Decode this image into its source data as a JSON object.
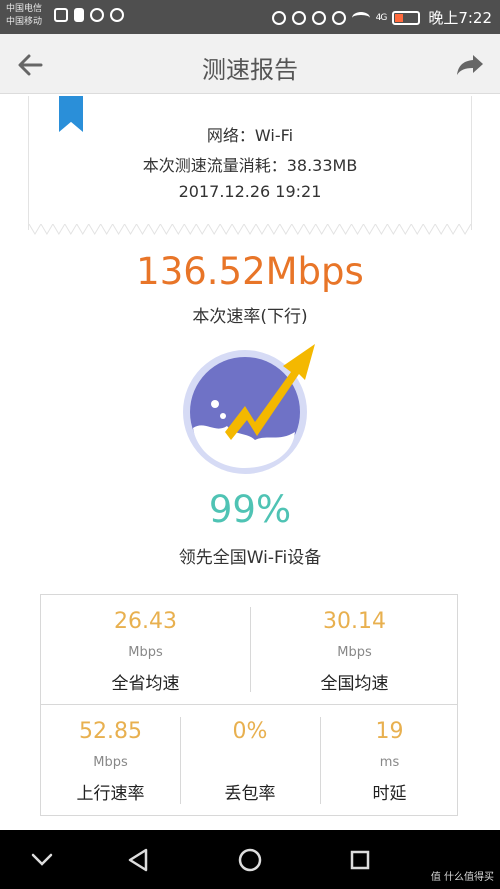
{
  "status_bar": {
    "carrier_line1": "中国电信",
    "carrier_line2": "中国移动",
    "time": "晚上7:22",
    "signal_label": "4G"
  },
  "app_bar": {
    "title": "测速报告",
    "back_icon": "arrow-left-icon",
    "share_icon": "share-icon"
  },
  "ticket": {
    "network": "网络：Wi-Fi",
    "traffic": "本次测速流量消耗：38.33MB",
    "datetime": "2017.12.26  19:21"
  },
  "speed": {
    "value": "136.52Mbps",
    "label": "本次速率(下行)"
  },
  "ranking": {
    "percent": "99%",
    "label": "领先全国Wi-Fi设备"
  },
  "stats": {
    "province": {
      "value": "26.43",
      "unit": "Mbps",
      "label": "全省均速"
    },
    "national": {
      "value": "30.14",
      "unit": "Mbps",
      "label": "全国均速"
    },
    "upload": {
      "value": "52.85",
      "unit": "Mbps",
      "label": "上行速率"
    },
    "packet_loss": {
      "value": "0%",
      "unit": "",
      "label": "丢包率"
    },
    "latency": {
      "value": "19",
      "unit": "ms",
      "label": "时延"
    }
  },
  "colors": {
    "speed": "#e87528",
    "percent": "#4fc3b4",
    "stat_value": "#e8b04f",
    "bookmark": "#2a8fd9"
  },
  "watermark": "值 什么值得买"
}
